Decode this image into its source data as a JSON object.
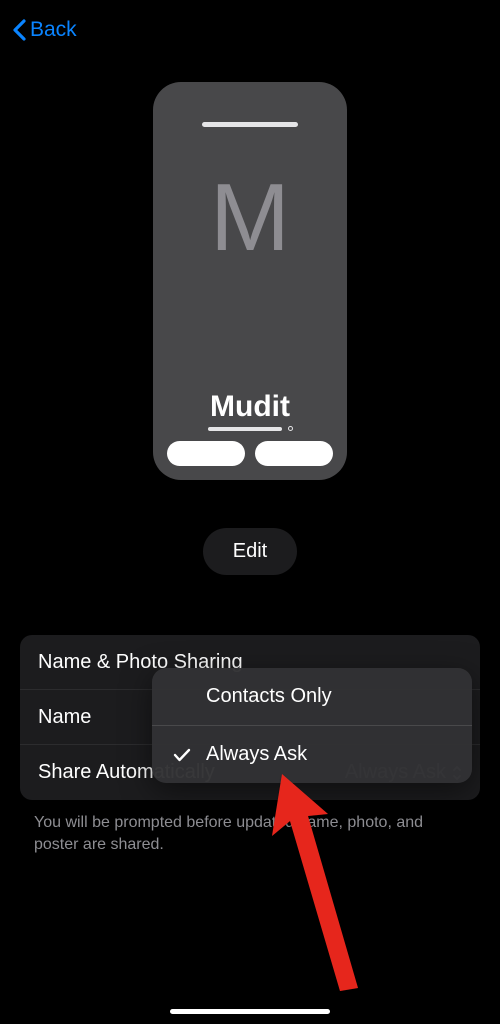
{
  "nav": {
    "back": "Back"
  },
  "card": {
    "initial": "M",
    "name": "Mudit"
  },
  "edit_button": "Edit",
  "settings": {
    "name_photo_label": "Name & Photo Sharing",
    "name_label": "Name",
    "share_auto_label": "Share Automatically",
    "share_auto_value": "Always Ask"
  },
  "footer": "You will be prompted before updated name, photo, and poster are shared.",
  "popover": {
    "contacts_only": "Contacts Only",
    "always_ask": "Always Ask"
  }
}
